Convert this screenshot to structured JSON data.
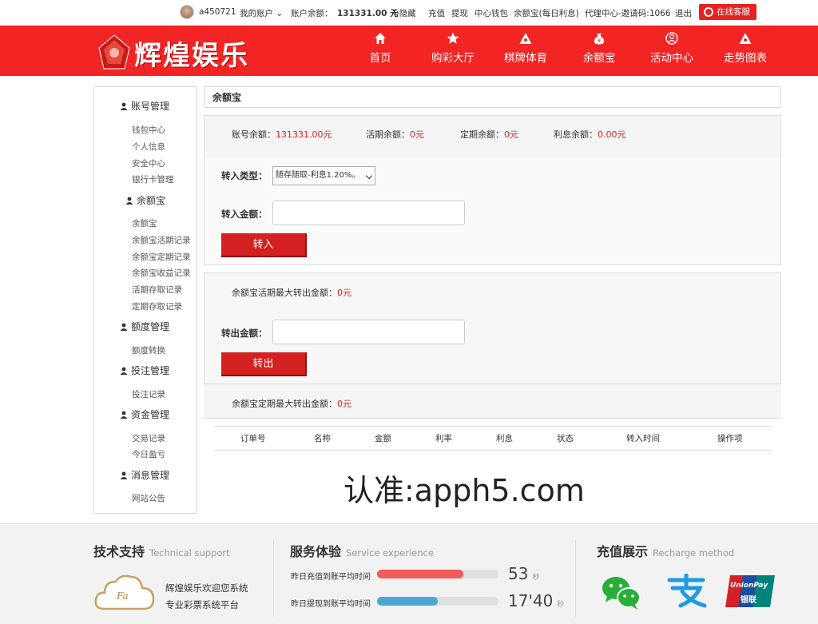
{
  "topbar": {
    "username": "a450721",
    "my_account": "我的账户",
    "balance_label": "账户余额：",
    "balance_value": "131331.00 元",
    "hide": "隐藏",
    "deposit": "充值",
    "withdraw": "提现",
    "wallet": "中心钱包",
    "yuebao_promo": "余额宝(每日利息)",
    "agent_center": "代理中心-邀请码:1066",
    "logout": "退出",
    "online_service": "在线客服"
  },
  "header": {
    "logo_text": "辉煌娱乐",
    "nav": [
      {
        "label": "首页",
        "icon": "home-icon"
      },
      {
        "label": "购彩大厅",
        "icon": "star-icon"
      },
      {
        "label": "棋牌体育",
        "icon": "triangle-icon"
      },
      {
        "label": "余额宝",
        "icon": "money-bag-icon"
      },
      {
        "label": "活动中心",
        "icon": "user-circle-icon"
      },
      {
        "label": "走势图表",
        "icon": "triangle-icon"
      }
    ]
  },
  "sidebar": {
    "groups": [
      {
        "title": "账号管理",
        "items": [
          "钱包中心",
          "个人信息",
          "安全中心",
          "银行卡管理"
        ]
      },
      {
        "title": "余额宝",
        "items": [
          "余额宝",
          "余额宝活期记录",
          "余额宝定期记录",
          "余额宝收益记录",
          "活期存取记录",
          "定期存取记录"
        ]
      },
      {
        "title": "额度管理",
        "items": [
          "额度转换"
        ]
      },
      {
        "title": "投注管理",
        "items": [
          "投注记录"
        ]
      },
      {
        "title": "资金管理",
        "items": [
          "交易记录",
          "今日盈亏"
        ]
      },
      {
        "title": "消息管理",
        "items": [
          "网站公告"
        ]
      }
    ]
  },
  "main": {
    "title": "余额宝",
    "stats": {
      "account_label": "账号余额：",
      "account_value": "131331.00元",
      "current_label": "活期余额：",
      "current_value": "0元",
      "fixed_label": "定期余额：",
      "fixed_value": "0元",
      "interest_label": "利息余额：",
      "interest_value": "0.00元"
    },
    "transfer_in": {
      "type_label": "转入类型：",
      "type_selected": "随存随取-利息1.20%。",
      "amount_label": "转入金额：",
      "amount_value": "",
      "button": "转入"
    },
    "transfer_out": {
      "max_label": "余额宝活期最大转出金额：",
      "max_value": "0元",
      "amount_label": "转出金额：",
      "amount_value": "",
      "button": "转出"
    },
    "fixed_max": {
      "label": "余额宝定期最大转出金额：",
      "value": "0元"
    },
    "table_headers": [
      "订单号",
      "名称",
      "金额",
      "利率",
      "利息",
      "状态",
      "转入时间",
      "操作项"
    ]
  },
  "watermark": "认准:apph5.com",
  "footer": {
    "support": {
      "title": "技术支持",
      "en": "Technical support",
      "line1": "辉煌娱乐欢迎您系统",
      "line2": "专业彩票系统平台",
      "logo_letters": "Fa"
    },
    "service": {
      "title": "服务体验",
      "en": "Service experience",
      "deposit_label": "昨日充值到账平均时间",
      "deposit_value": "53",
      "deposit_unit": "秒",
      "deposit_fill": 0.71,
      "withdraw_label": "昨日提现到账平均时间",
      "withdraw_value": "17'40",
      "withdraw_unit": "秒",
      "withdraw_fill": 0.5
    },
    "recharge": {
      "title": "充值展示",
      "en": "Recharge method",
      "unionpay_top": "UnionPay",
      "unionpay_bottom": "银联"
    }
  },
  "colors": {
    "brand_red": "#f32424",
    "accent_red": "#e02020",
    "bar_red": "#f05a5a",
    "bar_blue": "#4aa8d8"
  }
}
